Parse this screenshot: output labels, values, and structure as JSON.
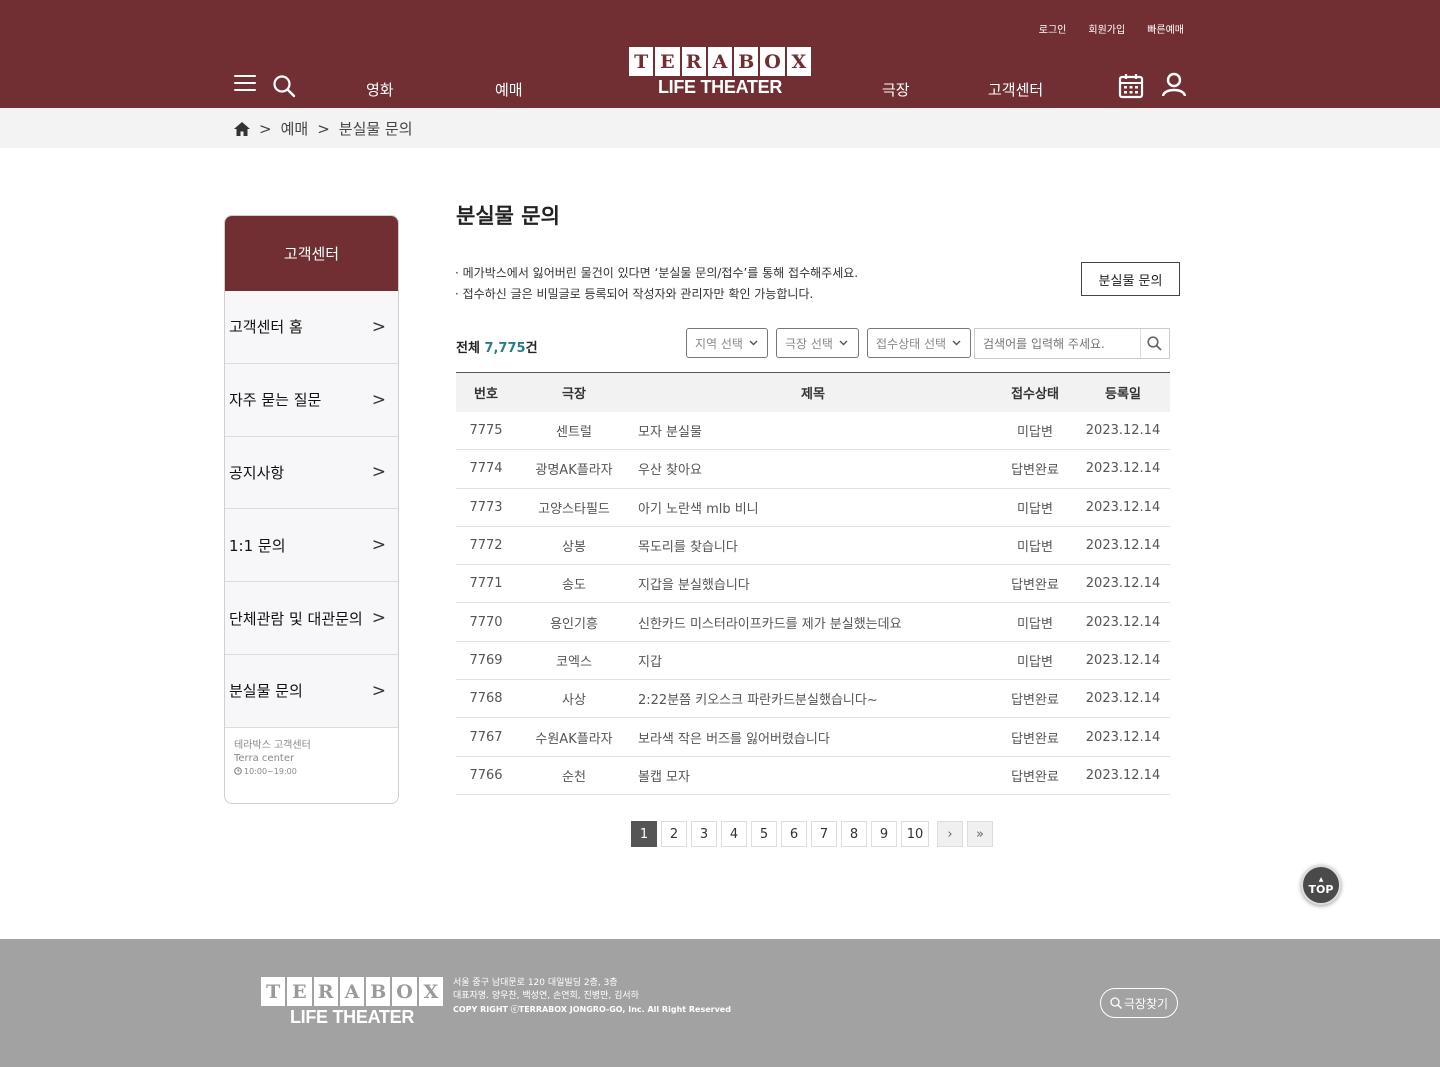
{
  "header": {
    "top_links": [
      "로그인",
      "회원가입",
      "빠른예매"
    ],
    "nav": {
      "movie": "영화",
      "booking": "예매",
      "theater": "극장",
      "support": "고객센터"
    },
    "logo": {
      "letters": [
        "T",
        "E",
        "R",
        "A",
        "B",
        "O",
        "X"
      ],
      "subtitle": "LIFE THEATER"
    },
    "brand_color": "#722f33"
  },
  "breadcrumb": {
    "items": [
      "예매",
      "분실물 문의"
    ],
    "separator": ">"
  },
  "sidebar": {
    "title": "고객센터",
    "items": [
      {
        "label": "고객센터 홈"
      },
      {
        "label": "자주 묻는 질문"
      },
      {
        "label": "공지사항"
      },
      {
        "label": "1:1 문의"
      },
      {
        "label": "단체관람 및 대관문의"
      },
      {
        "label": "분실물 문의"
      }
    ],
    "arrow": ">",
    "info": {
      "line1": "테라박스 고객센터",
      "line2": "Terra center",
      "hours": "10:00~19:00"
    }
  },
  "main": {
    "title": "분실물 문의",
    "notice": [
      "· 메가박스에서 잃어버린 물건이 있다면 ‘분실물 문의/접수’를 통해 접수해주세요.",
      "· 접수하신 글은 비밀글로 등록되어 작성자와 관리자만 확인 가능합니다."
    ],
    "lost_button": "분실물 문의",
    "total_label": "전체",
    "total_count": "7,775",
    "total_unit": "건",
    "filters": {
      "region": "지역 선택",
      "theater": "극장 선택",
      "status": "접수상태 선택"
    },
    "search_placeholder": "검색어를 입력해 주세요.",
    "table": {
      "headers": [
        "번호",
        "극장",
        "제목",
        "접수상태",
        "등록일"
      ],
      "rows": [
        {
          "no": "7775",
          "theater": "센트럴",
          "title": "모자 분실물",
          "status": "미답변",
          "date": "2023.12.14"
        },
        {
          "no": "7774",
          "theater": "광명AK플라자",
          "title": "우산 찾아요",
          "status": "답변완료",
          "date": "2023.12.14"
        },
        {
          "no": "7773",
          "theater": "고양스타필드",
          "title": "아기 노란색 mlb 비니",
          "status": "미답변",
          "date": "2023.12.14"
        },
        {
          "no": "7772",
          "theater": "상봉",
          "title": "목도리를 찾습니다",
          "status": "미답변",
          "date": "2023.12.14"
        },
        {
          "no": "7771",
          "theater": "송도",
          "title": "지갑을 분실했습니다",
          "status": "답변완료",
          "date": "2023.12.14"
        },
        {
          "no": "7770",
          "theater": "용인기흥",
          "title": "신한카드 미스터라이프카드를 제가 분실했는데요",
          "status": "미답변",
          "date": "2023.12.14"
        },
        {
          "no": "7769",
          "theater": "코엑스",
          "title": "지갑",
          "status": "미답변",
          "date": "2023.12.14"
        },
        {
          "no": "7768",
          "theater": "사상",
          "title": "2:22분쯤 키오스크 파란카드분실했습니다~",
          "status": "답변완료",
          "date": "2023.12.14"
        },
        {
          "no": "7767",
          "theater": "수원AK플라자",
          "title": "보라색 작은 버즈를 잃어버렸습니다",
          "status": "답변완료",
          "date": "2023.12.14"
        },
        {
          "no": "7766",
          "theater": "순천",
          "title": "볼캡 모자",
          "status": "답변완료",
          "date": "2023.12.14"
        }
      ]
    },
    "pagination": {
      "pages": [
        "1",
        "2",
        "3",
        "4",
        "5",
        "6",
        "7",
        "8",
        "9",
        "10"
      ],
      "current": "1",
      "next": "›",
      "last": "»"
    }
  },
  "top_button": {
    "arrow": "▲",
    "label": "TOP"
  },
  "footer": {
    "address": "서울 중구 남대문로 120 대일빌딩 2층, 3층",
    "representatives": "대표자명. 양우찬, 백성연, 손연희, 진병만, 김서하",
    "copyright": "COPY RIGHT ⓒTERRABOX JONGRO-GO, Inc. All Right Reserved",
    "find_theater": "극장찾기"
  }
}
